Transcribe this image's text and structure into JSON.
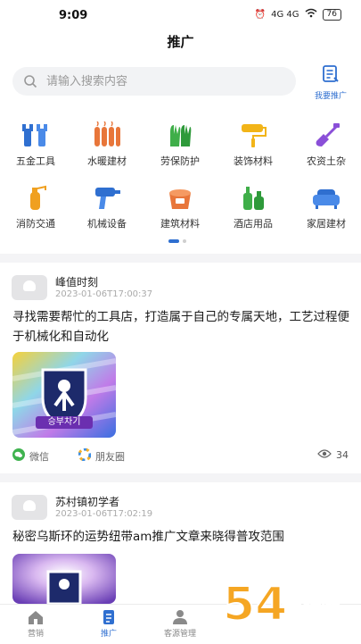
{
  "status": {
    "time": "9:09",
    "battery": "76",
    "signal": "4G 4G"
  },
  "header": {
    "title": "推广"
  },
  "search": {
    "placeholder": "请输入搜索内容"
  },
  "promote_button": {
    "label": "我要推广"
  },
  "categories": [
    {
      "label": "五金工具",
      "icon": "wrench-icon",
      "color": "#2f6fd0"
    },
    {
      "label": "水暖建材",
      "icon": "radiator-icon",
      "color": "#e8763a"
    },
    {
      "label": "劳保防护",
      "icon": "gloves-icon",
      "color": "#3fae49"
    },
    {
      "label": "装饰材料",
      "icon": "paint-roller-icon",
      "color": "#f2b418"
    },
    {
      "label": "农资土杂",
      "icon": "shovel-icon",
      "color": "#8a4fd8"
    },
    {
      "label": "消防交通",
      "icon": "fire-extinguisher-icon",
      "color": "#f0a020"
    },
    {
      "label": "机械设备",
      "icon": "drill-icon",
      "color": "#2f6fd0"
    },
    {
      "label": "建筑材料",
      "icon": "cement-bucket-icon",
      "color": "#e8763a"
    },
    {
      "label": "酒店用品",
      "icon": "bottles-icon",
      "color": "#3fae49"
    },
    {
      "label": "家居建材",
      "icon": "sofa-icon",
      "color": "#2f6fd0"
    }
  ],
  "posts": [
    {
      "user": "峰值时刻",
      "time": "2023-01-06T17:00:37",
      "text": "寻找需要帮忙的工具店，打造属于自己的专属天地，工艺过程便于机械化和自动化",
      "thumb_caption": "승부차기",
      "share_wechat": "微信",
      "share_moments": "朋友圈",
      "views": "34"
    },
    {
      "user": "苏村镇初学者",
      "time": "2023-01-06T17:02:19",
      "text": "秘密乌斯环的运势纽带am推广文章来晓得普攻范围"
    }
  ],
  "tabs": [
    {
      "label": "营销",
      "icon": "home-icon"
    },
    {
      "label": "推广",
      "icon": "document-icon"
    },
    {
      "label": "客源管理",
      "icon": "person-icon"
    }
  ],
  "active_tab": "推广",
  "colors": {
    "accent": "#2f6fd0"
  },
  "watermark": {
    "text": "54手游网"
  }
}
